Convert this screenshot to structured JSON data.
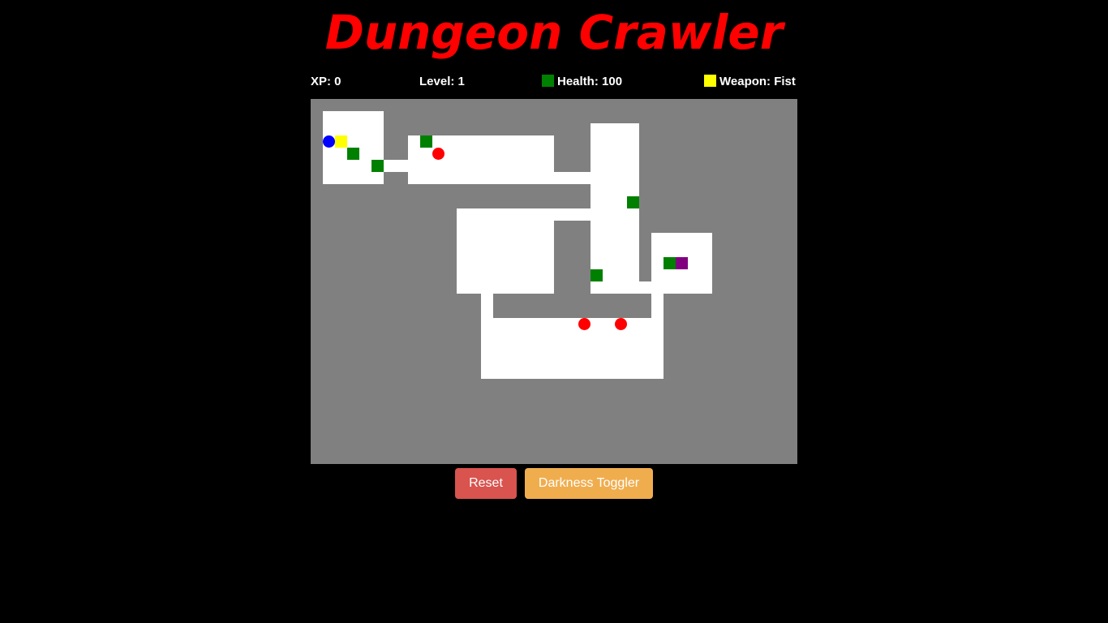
{
  "title": "Dungeon Crawler",
  "stats": {
    "xp_label": "XP: 0",
    "level_label": "Level: 1",
    "health_label": "Health: 100",
    "weapon_label": "Weapon: Fist",
    "xp": 0,
    "level": 1,
    "health": 100,
    "weapon": "Fist"
  },
  "buttons": {
    "reset": "Reset",
    "darkness": "Darkness Toggler"
  },
  "colors": {
    "title": "#ff0000",
    "wall": "#808080",
    "floor": "#ffffff",
    "player": "#0000ff",
    "enemy": "#ff0000",
    "health_pack": "#008000",
    "weapon": "#ffff00",
    "stairs": "#800080",
    "reset_button": "#d9534f",
    "darkness_button": "#f0ad4e"
  },
  "legend": {
    "health_icon": "green-square-icon",
    "weapon_icon": "yellow-square-icon"
  },
  "map": {
    "cell": 15,
    "cols": 40,
    "rows": 30,
    "rooms": [
      [
        1,
        1,
        5,
        6
      ],
      [
        8,
        3,
        12,
        4
      ],
      [
        23,
        2,
        4,
        14
      ],
      [
        12,
        9,
        8,
        7
      ],
      [
        28,
        11,
        5,
        5
      ],
      [
        14,
        18,
        15,
        5
      ]
    ],
    "corridors": [
      [
        6,
        5,
        2,
        1
      ],
      [
        20,
        6,
        3,
        1
      ],
      [
        20,
        9,
        3,
        1
      ],
      [
        27,
        15,
        1,
        1
      ],
      [
        14,
        16,
        1,
        2
      ],
      [
        28,
        16,
        1,
        2
      ]
    ],
    "player": [
      1,
      3
    ],
    "enemies": [
      [
        10,
        4
      ],
      [
        22,
        18
      ],
      [
        25,
        18
      ]
    ],
    "health_packs": [
      [
        3,
        4
      ],
      [
        5,
        5
      ],
      [
        9,
        3
      ],
      [
        26,
        8
      ],
      [
        23,
        14
      ],
      [
        29,
        13
      ]
    ],
    "weapons": [
      [
        2,
        3
      ]
    ],
    "stairs": [
      [
        30,
        13
      ]
    ]
  }
}
